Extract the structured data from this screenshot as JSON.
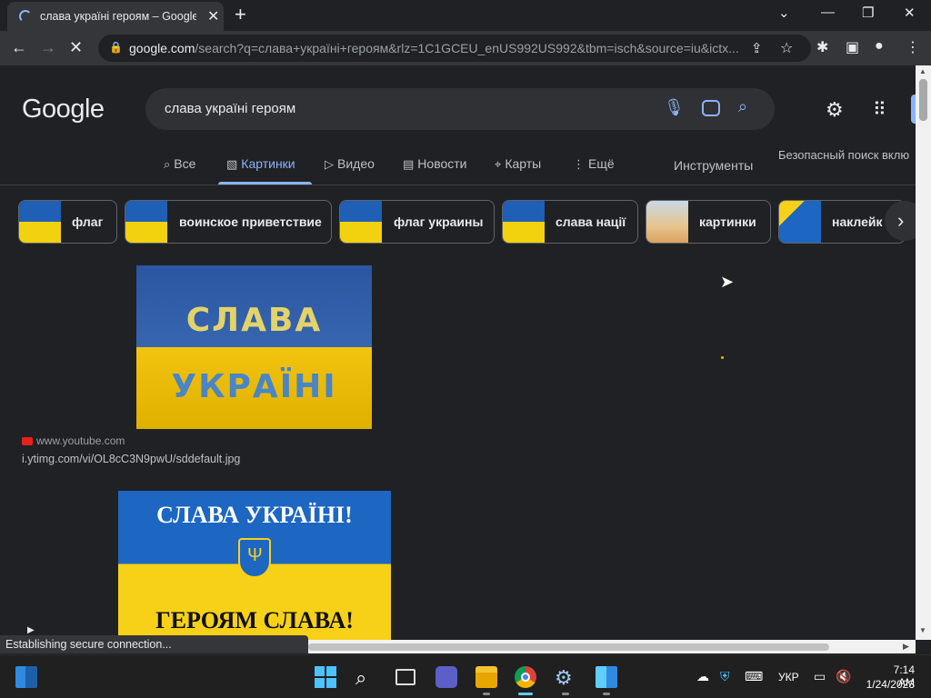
{
  "browser": {
    "tab_title": "слава україні героям – Google П",
    "url_host": "google.com",
    "url_path": "/search?q=слава+україні+героям&rlz=1C1GCEU_enUS992US992&tbm=isch&source=iu&ictx...",
    "status_text": "Establishing secure connection..."
  },
  "google": {
    "logo": "Google",
    "query": "слава україні героям",
    "tabs": [
      {
        "label": "Все",
        "icon": "search-icon"
      },
      {
        "label": "Картинки",
        "icon": "image-icon"
      },
      {
        "label": "Видео",
        "icon": "video-icon"
      },
      {
        "label": "Новости",
        "icon": "news-icon"
      },
      {
        "label": "Карты",
        "icon": "map-pin-icon"
      },
      {
        "label": "Ещё",
        "icon": "more-vert-icon"
      }
    ],
    "tools_label": "Инструменты",
    "safesearch_label": "Безопасный поиск вклю",
    "chips": [
      {
        "label": "флаг"
      },
      {
        "label": "воинское приветствие"
      },
      {
        "label": "флаг украины"
      },
      {
        "label": "слава нації"
      },
      {
        "label": "картинки"
      },
      {
        "label": "наклейк"
      }
    ],
    "results": [
      {
        "image_text_1": "СЛАВА",
        "image_text_2": "УКРАЇНІ",
        "source": "www.youtube.com",
        "url": "i.ytimg.com/vi/OL8cC3N9pwU/sddefault.jpg"
      },
      {
        "image_text_1": "СЛАВА УКРАЇНІ!",
        "image_text_2": "ГЕРОЯМ СЛАВА!"
      }
    ]
  },
  "taskbar": {
    "language": "УКР",
    "time": "7:14 AM",
    "date": "1/24/2023"
  },
  "colors": {
    "accent": "#8ab4f8",
    "flag_blue": "#1d66c2",
    "flag_yellow": "#f7d117"
  }
}
